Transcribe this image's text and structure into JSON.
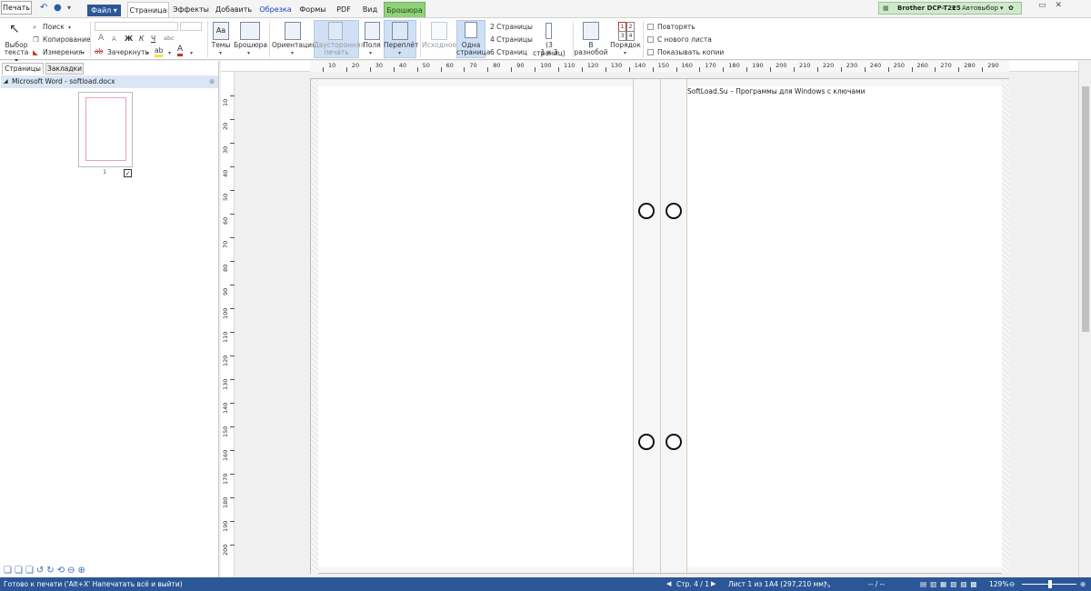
{
  "menu": {
    "print_label": "Печать",
    "file_label": "Файл ▾",
    "tabs": [
      "Страница",
      "Эффекты",
      "Добавить",
      "Обрезка",
      "Формы",
      "PDF",
      "Вид",
      "Брошюра"
    ],
    "printer": "Brother DCP-T225",
    "autoselect": "Автовыбор"
  },
  "ribbon": {
    "select_text": [
      "Выбор",
      "текста ▾"
    ],
    "search": "Поиск",
    "copy": "Копирование",
    "measure": "Измерения",
    "strikeout": "Зачеркнуть",
    "format_buttons": [
      "A",
      "A",
      "Ж",
      "К",
      "Ч",
      "abc"
    ],
    "themes": "Темы",
    "brochure": "Брошюра",
    "orientation": "Ориентация",
    "duplex": [
      "Двусторонняя",
      "печать"
    ],
    "margins": "Поля",
    "binding": "Переплёт",
    "original": "Исходное",
    "one_page": [
      "Одна",
      "страница"
    ],
    "pages_2": "2 Страницы",
    "pages_4": "4 Страницы",
    "pages_6": "6 Страниц",
    "pages_3": [
      "(3 страниц)",
      "1 x 3"
    ],
    "scattered": [
      "В",
      "разнобой"
    ],
    "order": "Порядок",
    "order_digits": [
      "1",
      "2",
      "3",
      "4",
      "5",
      "6"
    ],
    "repeat": "Повторять",
    "new_sheet": "С нового листа",
    "show_copies": "Показывать копии"
  },
  "panel": {
    "tab_pages": "Страницы",
    "tab_bookmarks": "Закладки",
    "document": "Microsoft Word - softload.docx",
    "page_number": "1"
  },
  "ruler": {
    "h_labels": [
      "10",
      "20",
      "30",
      "40",
      "50",
      "60",
      "70",
      "80",
      "90",
      "100",
      "110",
      "120",
      "130",
      "140",
      "150",
      "160",
      "170",
      "180",
      "190",
      "200",
      "210",
      "220",
      "230",
      "240",
      "250",
      "260",
      "270",
      "280",
      "290"
    ],
    "v_labels": [
      "10",
      "20",
      "30",
      "40",
      "50",
      "60",
      "70",
      "80",
      "90",
      "100",
      "110",
      "120",
      "130",
      "140",
      "150",
      "160",
      "170",
      "180",
      "190",
      "200"
    ]
  },
  "document": {
    "text": "SoftLoad.Su – Программы для Windows с ключами"
  },
  "status": {
    "message": "Готово к печати ('Alt+X' Напечатать всё и выйти)",
    "page": "Стр. 4 / 1",
    "sheet": "Лист 1 из 1",
    "paper": "A4 (297,210 мм)",
    "extra": "-- / --",
    "zoom": "129%"
  },
  "colors": {
    "accent": "#2b5797",
    "brochure_tab": "#92d07c",
    "printer_bg": "#cfeacb"
  }
}
